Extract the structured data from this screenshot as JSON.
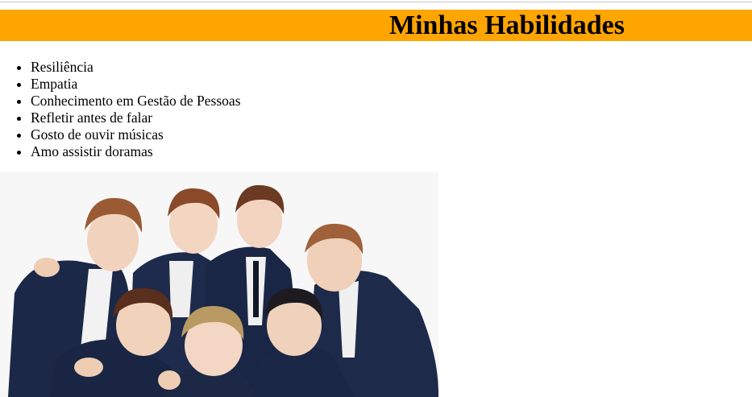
{
  "header": {
    "title": "Minhas Habilidades",
    "background_color": "#ffa500"
  },
  "skills": [
    "Resiliência",
    "Empatia",
    "Conhecimento em Gestão de Pessoas",
    "Refletir antes de falar",
    "Gosto de ouvir músicas",
    "Amo assistir doramas"
  ],
  "photo": {
    "subject": "group photo of seven people in navy suits"
  }
}
